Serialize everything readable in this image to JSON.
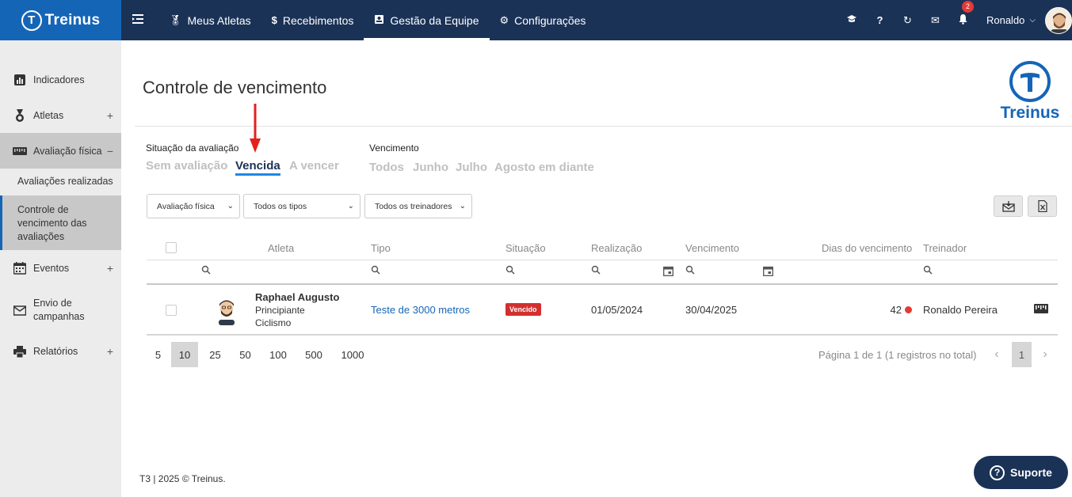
{
  "brand": {
    "name": "Treinus"
  },
  "nav": {
    "items": [
      {
        "label": "Meus Atletas",
        "icon": "medal-icon"
      },
      {
        "label": "Recebimentos",
        "icon": "dollar-icon"
      },
      {
        "label": "Gestão da Equipe",
        "icon": "id-card-icon",
        "active": true
      },
      {
        "label": "Configurações",
        "icon": "gears-icon"
      }
    ],
    "notifications_count": "2",
    "user_name": "Ronaldo"
  },
  "sidebar": {
    "items": [
      {
        "label": "Indicadores",
        "icon": "chart-icon"
      },
      {
        "label": "Atletas",
        "icon": "medal-icon",
        "expand": "+"
      },
      {
        "label": "Avaliação física",
        "icon": "ruler-icon",
        "expand": "−"
      },
      {
        "label": "Eventos",
        "icon": "calendar-icon",
        "expand": "+"
      },
      {
        "label": "Envio de campanhas",
        "icon": "mail-icon"
      },
      {
        "label": "Relatórios",
        "icon": "printer-icon",
        "expand": "+"
      }
    ],
    "subitems": [
      {
        "label": "Avaliações realizadas"
      },
      {
        "label": "Controle de vencimento das avaliações",
        "active": true
      }
    ]
  },
  "page": {
    "title": "Controle de vencimento",
    "logo_text": "Treinus"
  },
  "filters": {
    "situacao_label": "Situação da avaliação",
    "situacao_options": [
      "Sem avaliação",
      "Vencida",
      "A vencer"
    ],
    "situacao_selected": "Vencida",
    "vencimento_label": "Vencimento",
    "vencimento_options": [
      "Todos",
      "Junho",
      "Julho",
      "Agosto em diante"
    ]
  },
  "selects": [
    "Avaliação física",
    "Todos os tipos",
    "Todos os treinadores"
  ],
  "table": {
    "headers": [
      "Atleta",
      "Tipo",
      "Situação",
      "Realização",
      "Vencimento",
      "Dias do vencimento",
      "Treinador"
    ],
    "rows": [
      {
        "name": "Raphael Augusto",
        "level": "Principiante",
        "sport": "Ciclismo",
        "tipo": "Teste de 3000 metros",
        "situacao": "Vencido",
        "realizacao": "01/05/2024",
        "vencimento": "30/04/2025",
        "dias": "42",
        "treinador": "Ronaldo Pereira"
      }
    ]
  },
  "pagination": {
    "page_sizes": [
      "5",
      "10",
      "25",
      "50",
      "100",
      "500",
      "1000"
    ],
    "selected_size": "10",
    "info": "Página 1 de 1 (1 registros no total)",
    "current_page": "1"
  },
  "footer": {
    "text": "T3  | 2025 © Treinus."
  },
  "support": {
    "label": "Suporte"
  },
  "colors": {
    "navbar": "#1b3257",
    "brand": "#1565b7",
    "danger": "#d32f2f"
  }
}
